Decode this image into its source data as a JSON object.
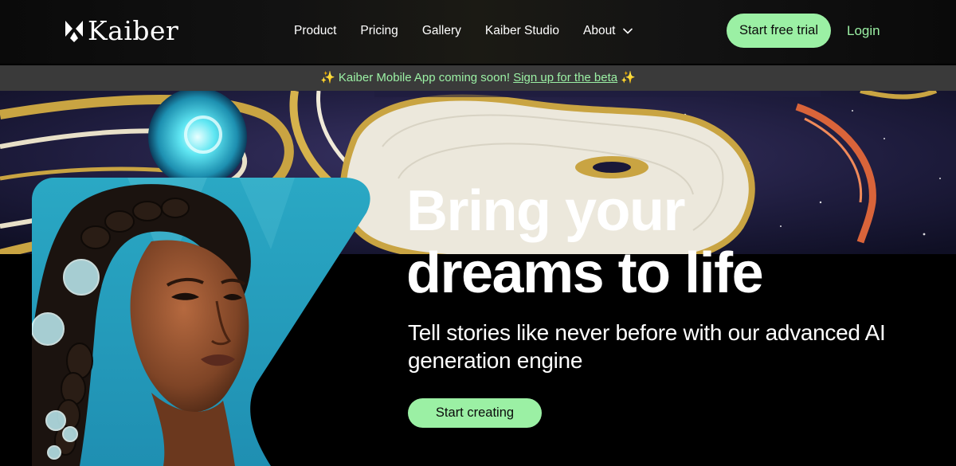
{
  "brand": {
    "name": "Kaiber"
  },
  "nav": {
    "items": [
      "Product",
      "Pricing",
      "Gallery",
      "Kaiber Studio",
      "About"
    ],
    "about_icon": "chevron-down-icon"
  },
  "header": {
    "cta_label": "Start free trial",
    "login_label": "Login"
  },
  "banner": {
    "sparkle_left": "✨",
    "text": "Kaiber Mobile App coming soon!",
    "link_label": "Sign up for the beta",
    "sparkle_right": "✨"
  },
  "hero": {
    "headline_line1": "Bring your",
    "headline_line2": "dreams to life",
    "subheadline": "Tell stories like never before with our advanced AI generation engine",
    "cta_label": "Start creating"
  },
  "colors": {
    "accent": "#9bf0a4",
    "background": "#000000",
    "banner_bg": "#3a3a3a",
    "sparkle": "#f5d442"
  }
}
